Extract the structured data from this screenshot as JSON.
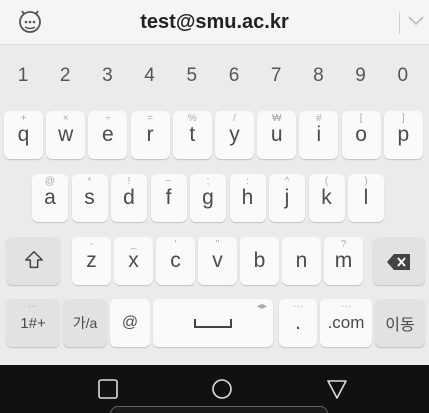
{
  "suggestion_bar": {
    "suggestion": "test@smu.ac.kr",
    "left_icon": "emoji-settings-icon",
    "right_icon": "chevron-down-icon"
  },
  "number_row": [
    "1",
    "2",
    "3",
    "4",
    "5",
    "6",
    "7",
    "8",
    "9",
    "0"
  ],
  "row1": [
    {
      "label": "q",
      "hint": "+"
    },
    {
      "label": "w",
      "hint": "×"
    },
    {
      "label": "e",
      "hint": "÷"
    },
    {
      "label": "r",
      "hint": "="
    },
    {
      "label": "t",
      "hint": "%"
    },
    {
      "label": "y",
      "hint": "/"
    },
    {
      "label": "u",
      "hint": "₩"
    },
    {
      "label": "i",
      "hint": "#"
    },
    {
      "label": "o",
      "hint": "["
    },
    {
      "label": "p",
      "hint": "]"
    }
  ],
  "row2": [
    {
      "label": "a",
      "hint": "@"
    },
    {
      "label": "s",
      "hint": "*"
    },
    {
      "label": "d",
      "hint": "!"
    },
    {
      "label": "f",
      "hint": "~"
    },
    {
      "label": "g",
      "hint": ";"
    },
    {
      "label": "h",
      "hint": ":"
    },
    {
      "label": "j",
      "hint": "^"
    },
    {
      "label": "k",
      "hint": "("
    },
    {
      "label": "l",
      "hint": ")"
    }
  ],
  "row3": [
    {
      "label": "z",
      "hint": "-"
    },
    {
      "label": "x",
      "hint": "_"
    },
    {
      "label": "c",
      "hint": "'"
    },
    {
      "label": "v",
      "hint": "\""
    },
    {
      "label": "b",
      "hint": ""
    },
    {
      "label": "n",
      "hint": ""
    },
    {
      "label": "m",
      "hint": "?"
    }
  ],
  "bottom_row": {
    "symbols": "1#+",
    "lang_switch": "가/a",
    "at": "@",
    "period": ".",
    "dotcom": ".com",
    "move": "이동"
  },
  "icons": {
    "shift": "shift-icon",
    "backspace": "backspace-icon",
    "space": "spacebar-icon",
    "back": "square-recents-icon",
    "home": "circle-home-icon",
    "recents": "triangle-back-icon"
  },
  "colors": {
    "keyboard_bg": "#ebebeb",
    "key_bg": "#fafafa",
    "func_key_bg": "#e2e2e2",
    "navbar_bg": "#111111"
  }
}
